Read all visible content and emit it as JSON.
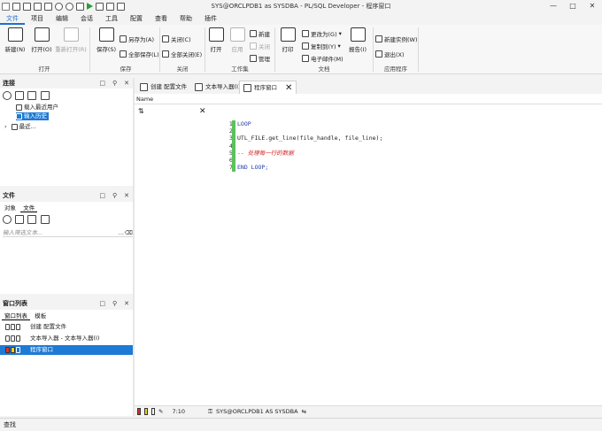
{
  "window": {
    "title": "SYS@ORCLPDB1 as SYSDBA - PL/SQL Developer - 程序窗口",
    "controls": [
      "—",
      "□",
      "✕"
    ]
  },
  "menu": [
    "文件",
    "项目",
    "编辑",
    "会话",
    "工具",
    "配置",
    "查看",
    "帮助",
    "插件"
  ],
  "ribbon": {
    "groups": [
      {
        "label": "打开"
      },
      {
        "label": "保存"
      },
      {
        "label": "关闭"
      },
      {
        "label": "工作集"
      },
      {
        "label": "文档"
      },
      {
        "label": "应用程序"
      }
    ],
    "buttons": {
      "new": "新建(N)",
      "open": "打开(O)",
      "reopen": "重新打开(R)",
      "save": "保存(S)",
      "save_as": "另存为(A)",
      "save_all": "全部保存(L)",
      "close": "关闭(C)",
      "close_all": "全部关闭(E)",
      "ws_open": "打开",
      "ws_apply": "应用",
      "ws_new": "新建",
      "ws_close": "关闭",
      "ws_manage": "管理",
      "print": "打印",
      "change_to": "更改为(G)",
      "copy_to": "复制到(Y)",
      "email": "电子邮件(M)",
      "report": "报告(I)",
      "new_instance": "新建实例(W)",
      "exit": "退出(X)"
    }
  },
  "connection_panel": {
    "title": "连接",
    "items": [
      "载入最近用户",
      "输入历史",
      "最近..."
    ]
  },
  "files_panel": {
    "title": "文件",
    "tabs": [
      "对象",
      "文件"
    ],
    "filter_placeholder": "输入筛选文本...",
    "filter_more": "..."
  },
  "window_list_panel": {
    "title": "窗口列表",
    "tabs": [
      "窗口列表",
      "模板"
    ],
    "rows": [
      "创建 配置文件",
      "文本导入器 - 文本导入器(I)",
      "程序窗口"
    ]
  },
  "document_tabs": [
    "创建 配置文件",
    "文本导入器(I)",
    "程序窗口"
  ],
  "editor": {
    "name_header": "Name",
    "line_numbers": [
      "1",
      "2",
      "3",
      "4",
      "5",
      "6",
      "7"
    ],
    "lines": [
      "LOOP",
      "",
      "UTL_FILE.get_line(file_handle, file_line);",
      "",
      "-- 处理每一行的数据",
      "",
      "END LOOP;"
    ],
    "cursor_pos": "7:10",
    "connection": "SYS@ORCLPDB1 AS SYSDBA"
  },
  "status": {
    "text": "查找"
  }
}
